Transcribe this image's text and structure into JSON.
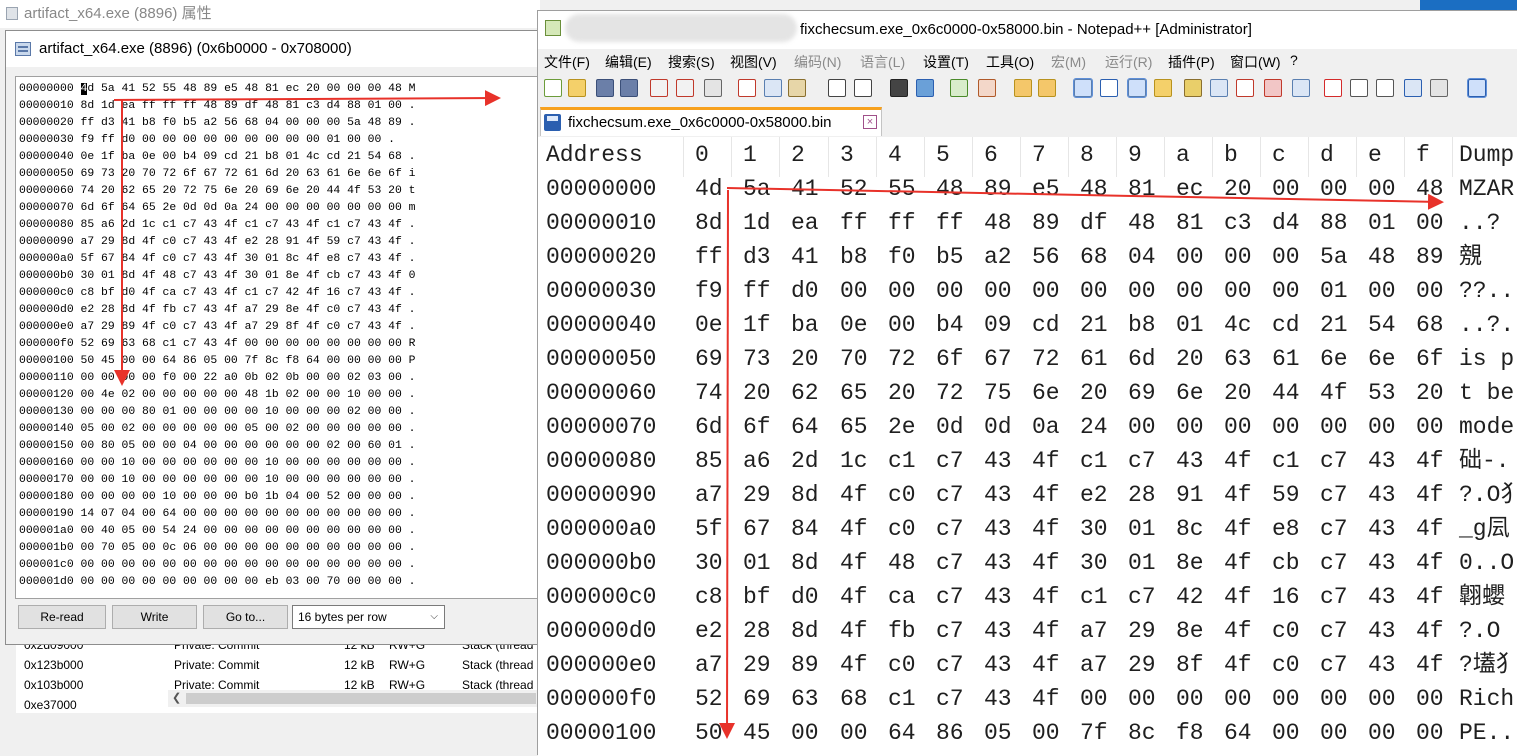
{
  "background": {
    "title": "artifact_x64.exe (8896) 属性"
  },
  "hex_window": {
    "title": "artifact_x64.exe (8896) (0x6b0000 - 0x708000)",
    "rows": [
      "00000000 4d 5a 41 52 55 48 89 e5 48 81 ec 20 00 00 00 48 M",
      "00000010 8d 1d ea ff ff ff 48 89 df 48 81 c3 d4 88 01 00 .",
      "00000020 ff d3 41 b8 f0 b5 a2 56 68 04 00 00 00 5a 48 89 .",
      "00000030 f9 ff d0 00 00 00 00 00 00 00 00 00 01 00 00 .",
      "00000040 0e 1f ba 0e 00 b4 09 cd 21 b8 01 4c cd 21 54 68 .",
      "00000050 69 73 20 70 72 6f 67 72 61 6d 20 63 61 6e 6e 6f i",
      "00000060 74 20 62 65 20 72 75 6e 20 69 6e 20 44 4f 53 20 t",
      "00000070 6d 6f 64 65 2e 0d 0d 0a 24 00 00 00 00 00 00 00 m",
      "00000080 85 a6 2d 1c c1 c7 43 4f c1 c7 43 4f c1 c7 43 4f .",
      "00000090 a7 29 8d 4f c0 c7 43 4f e2 28 91 4f 59 c7 43 4f .",
      "000000a0 5f 67 84 4f c0 c7 43 4f 30 01 8c 4f e8 c7 43 4f .",
      "000000b0 30 01 8d 4f 48 c7 43 4f 30 01 8e 4f cb c7 43 4f 0",
      "000000c0 c8 bf d0 4f ca c7 43 4f c1 c7 42 4f 16 c7 43 4f .",
      "000000d0 e2 28 8d 4f fb c7 43 4f a7 29 8e 4f c0 c7 43 4f .",
      "000000e0 a7 29 89 4f c0 c7 43 4f a7 29 8f 4f c0 c7 43 4f .",
      "000000f0 52 69 63 68 c1 c7 43 4f 00 00 00 00 00 00 00 00 R",
      "00000100 50 45 00 00 64 86 05 00 7f 8c f8 64 00 00 00 00 P",
      "00000110 00 00 00 00 f0 00 22 a0 0b 02 0b 00 00 02 03 00 .",
      "00000120 00 4e 02 00 00 00 00 00 48 1b 02 00 00 10 00 00 .",
      "00000130 00 00 00 80 01 00 00 00 00 10 00 00 00 02 00 00 .",
      "00000140 05 00 02 00 00 00 00 00 05 00 02 00 00 00 00 00 .",
      "00000150 00 80 05 00 00 04 00 00 00 00 00 00 02 00 60 01 .",
      "00000160 00 00 10 00 00 00 00 00 00 10 00 00 00 00 00 00 .",
      "00000170 00 00 10 00 00 00 00 00 00 10 00 00 00 00 00 00 .",
      "00000180 00 00 00 00 10 00 00 00 b0 1b 04 00 52 00 00 00 .",
      "00000190 14 07 04 00 64 00 00 00 00 00 00 00 00 00 00 00 .",
      "000001a0 00 40 05 00 54 24 00 00 00 00 00 00 00 00 00 00 .",
      "000001b0 00 70 05 00 0c 06 00 00 00 00 00 00 00 00 00 00 .",
      "000001c0 00 00 00 00 00 00 00 00 00 00 00 00 00 00 00 00 .",
      "000001d0 00 00 00 00 00 00 00 00 00 eb 03 00 70 00 00 00 ."
    ],
    "buttons": {
      "reread": "Re-read",
      "write": "Write",
      "goto": "Go to..."
    },
    "bytes_per_row": "16 bytes per row"
  },
  "memory_list": {
    "rows": [
      {
        "address": "0x2d09000",
        "type": "Private: Commit",
        "size": "12 kB",
        "protect": "RW+G",
        "use": "Stack (thread"
      },
      {
        "address": "0x123b000",
        "type": "Private: Commit",
        "size": "12 kB",
        "protect": "RW+G",
        "use": "Stack (thread"
      },
      {
        "address": "0x103b000",
        "type": "Private: Commit",
        "size": "12 kB",
        "protect": "RW+G",
        "use": "Stack (thread"
      },
      {
        "address": "0xe37000",
        "type": "",
        "size": "",
        "protect": "",
        "use": ""
      }
    ]
  },
  "notepad": {
    "title": "fixchecsum.exe_0x6c0000-0x58000.bin - Notepad++ [Administrator]",
    "menus": [
      "文件(F)",
      "编辑(E)",
      "搜索(S)",
      "视图(V)",
      "编码(N)",
      "语言(L)",
      "设置(T)",
      "工具(O)",
      "宏(M)",
      "运行(R)",
      "插件(P)",
      "窗口(W)",
      "?"
    ],
    "tab_label": "fixchecsum.exe_0x6c0000-0x58000.bin",
    "tab_close": "×",
    "header": [
      "Address",
      "0",
      "1",
      "2",
      "3",
      "4",
      "5",
      "6",
      "7",
      "8",
      "9",
      "a",
      "b",
      "c",
      "d",
      "e",
      "f",
      "Dump"
    ],
    "rows": [
      {
        "addr": "00000000",
        "bytes": [
          "4d",
          "5a",
          "41",
          "52",
          "55",
          "48",
          "89",
          "e5",
          "48",
          "81",
          "ec",
          "20",
          "00",
          "00",
          "00",
          "48"
        ],
        "dump": "MZAR"
      },
      {
        "addr": "00000010",
        "bytes": [
          "8d",
          "1d",
          "ea",
          "ff",
          "ff",
          "ff",
          "48",
          "89",
          "df",
          "48",
          "81",
          "c3",
          "d4",
          "88",
          "01",
          "00"
        ],
        "dump": "..?"
      },
      {
        "addr": "00000020",
        "bytes": [
          "ff",
          "d3",
          "41",
          "b8",
          "f0",
          "b5",
          "a2",
          "56",
          "68",
          "04",
          "00",
          "00",
          "00",
          "5a",
          "48",
          "89"
        ],
        "dump": "  覫"
      },
      {
        "addr": "00000030",
        "bytes": [
          "f9",
          "ff",
          "d0",
          "00",
          "00",
          "00",
          "00",
          "00",
          "00",
          "00",
          "00",
          "00",
          "00",
          "01",
          "00",
          "00"
        ],
        "dump": "??.."
      },
      {
        "addr": "00000040",
        "bytes": [
          "0e",
          "1f",
          "ba",
          "0e",
          "00",
          "b4",
          "09",
          "cd",
          "21",
          "b8",
          "01",
          "4c",
          "cd",
          "21",
          "54",
          "68"
        ],
        "dump": "..?."
      },
      {
        "addr": "00000050",
        "bytes": [
          "69",
          "73",
          "20",
          "70",
          "72",
          "6f",
          "67",
          "72",
          "61",
          "6d",
          "20",
          "63",
          "61",
          "6e",
          "6e",
          "6f"
        ],
        "dump": "is p"
      },
      {
        "addr": "00000060",
        "bytes": [
          "74",
          "20",
          "62",
          "65",
          "20",
          "72",
          "75",
          "6e",
          "20",
          "69",
          "6e",
          "20",
          "44",
          "4f",
          "53",
          "20"
        ],
        "dump": "t be"
      },
      {
        "addr": "00000070",
        "bytes": [
          "6d",
          "6f",
          "64",
          "65",
          "2e",
          "0d",
          "0d",
          "0a",
          "24",
          "00",
          "00",
          "00",
          "00",
          "00",
          "00",
          "00"
        ],
        "dump": "mode"
      },
      {
        "addr": "00000080",
        "bytes": [
          "85",
          "a6",
          "2d",
          "1c",
          "c1",
          "c7",
          "43",
          "4f",
          "c1",
          "c7",
          "43",
          "4f",
          "c1",
          "c7",
          "43",
          "4f"
        ],
        "dump": "础-."
      },
      {
        "addr": "00000090",
        "bytes": [
          "a7",
          "29",
          "8d",
          "4f",
          "c0",
          "c7",
          "43",
          "4f",
          "e2",
          "28",
          "91",
          "4f",
          "59",
          "c7",
          "43",
          "4f"
        ],
        "dump": "?.O犭"
      },
      {
        "addr": "000000a0",
        "bytes": [
          "5f",
          "67",
          "84",
          "4f",
          "c0",
          "c7",
          "43",
          "4f",
          "30",
          "01",
          "8c",
          "4f",
          "e8",
          "c7",
          "43",
          "4f"
        ],
        "dump": "_g凨"
      },
      {
        "addr": "000000b0",
        "bytes": [
          "30",
          "01",
          "8d",
          "4f",
          "48",
          "c7",
          "43",
          "4f",
          "30",
          "01",
          "8e",
          "4f",
          "cb",
          "c7",
          "43",
          "4f"
        ],
        "dump": "0..O"
      },
      {
        "addr": "000000c0",
        "bytes": [
          "c8",
          "bf",
          "d0",
          "4f",
          "ca",
          "c7",
          "43",
          "4f",
          "c1",
          "c7",
          "42",
          "4f",
          "16",
          "c7",
          "43",
          "4f"
        ],
        "dump": "翺蠳"
      },
      {
        "addr": "000000d0",
        "bytes": [
          "e2",
          "28",
          "8d",
          "4f",
          "fb",
          "c7",
          "43",
          "4f",
          "a7",
          "29",
          "8e",
          "4f",
          "c0",
          "c7",
          "43",
          "4f"
        ],
        "dump": "?.O"
      },
      {
        "addr": "000000e0",
        "bytes": [
          "a7",
          "29",
          "89",
          "4f",
          "c0",
          "c7",
          "43",
          "4f",
          "a7",
          "29",
          "8f",
          "4f",
          "c0",
          "c7",
          "43",
          "4f"
        ],
        "dump": "?壒犭"
      },
      {
        "addr": "000000f0",
        "bytes": [
          "52",
          "69",
          "63",
          "68",
          "c1",
          "c7",
          "43",
          "4f",
          "00",
          "00",
          "00",
          "00",
          "00",
          "00",
          "00",
          "00"
        ],
        "dump": "Rich"
      },
      {
        "addr": "00000100",
        "bytes": [
          "50",
          "45",
          "00",
          "00",
          "64",
          "86",
          "05",
          "00",
          "7f",
          "8c",
          "f8",
          "64",
          "00",
          "00",
          "00",
          "00"
        ],
        "dump": "PE.."
      }
    ]
  },
  "colors": {
    "annotation_arrow": "#e8322a",
    "tab_accent": "#f7a11e",
    "desktop_blue": "#1b6ec2"
  }
}
